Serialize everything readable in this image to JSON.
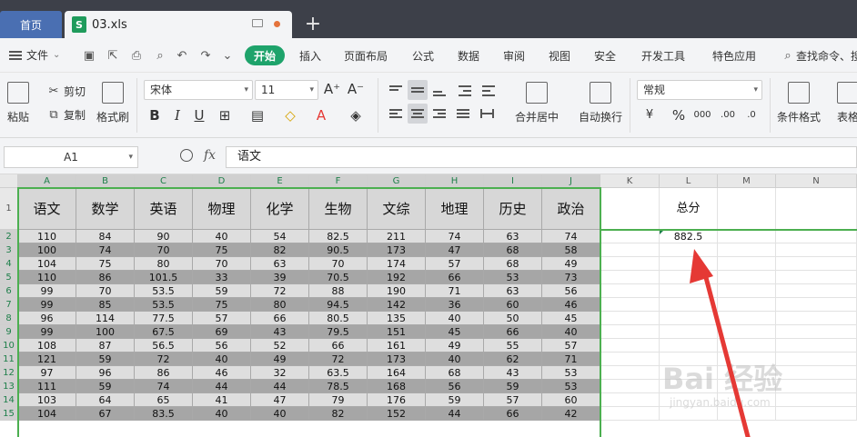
{
  "tabs": {
    "home": "首页",
    "file": "03.xls",
    "file_icon": "S",
    "add": "+"
  },
  "menu": {
    "file": "文件",
    "items": [
      "开始",
      "插入",
      "页面布局",
      "公式",
      "数据",
      "审阅",
      "视图",
      "安全",
      "开发工具",
      "特色应用"
    ],
    "search": "查找命令、搜"
  },
  "ribbon": {
    "paste": "粘贴",
    "cut": "剪切",
    "copy": "复制",
    "format_painter": "格式刷",
    "font_name": "宋体",
    "font_size": "11",
    "merge_center": "合并居中",
    "wrap_text": "自动换行",
    "number_format": "常规",
    "conditional_format": "条件格式",
    "table_style": "表格"
  },
  "formula_bar": {
    "cell_ref": "A1",
    "fx": "fx",
    "content": "语文"
  },
  "grid": {
    "columns": [
      "A",
      "B",
      "C",
      "D",
      "E",
      "F",
      "G",
      "H",
      "I",
      "J",
      "K",
      "L",
      "M",
      "N"
    ],
    "rows": [
      "1",
      "2",
      "3",
      "4",
      "5",
      "6",
      "7",
      "8",
      "9",
      "10",
      "11",
      "12",
      "13",
      "14",
      "15"
    ],
    "headers": [
      "语文",
      "数学",
      "英语",
      "物理",
      "化学",
      "生物",
      "文综",
      "地理",
      "历史",
      "政治"
    ],
    "data": [
      [
        "110",
        "84",
        "90",
        "40",
        "54",
        "82.5",
        "211",
        "74",
        "63",
        "74"
      ],
      [
        "100",
        "74",
        "70",
        "75",
        "82",
        "90.5",
        "173",
        "47",
        "68",
        "58"
      ],
      [
        "104",
        "75",
        "80",
        "70",
        "63",
        "70",
        "174",
        "57",
        "68",
        "49"
      ],
      [
        "110",
        "86",
        "101.5",
        "33",
        "39",
        "70.5",
        "192",
        "66",
        "53",
        "73"
      ],
      [
        "99",
        "70",
        "53.5",
        "59",
        "72",
        "88",
        "190",
        "71",
        "63",
        "56"
      ],
      [
        "99",
        "85",
        "53.5",
        "75",
        "80",
        "94.5",
        "142",
        "36",
        "60",
        "46"
      ],
      [
        "96",
        "114",
        "77.5",
        "57",
        "66",
        "80.5",
        "135",
        "40",
        "50",
        "45"
      ],
      [
        "99",
        "100",
        "67.5",
        "69",
        "43",
        "79.5",
        "151",
        "45",
        "66",
        "40"
      ],
      [
        "108",
        "87",
        "56.5",
        "56",
        "52",
        "66",
        "161",
        "49",
        "55",
        "57"
      ],
      [
        "121",
        "59",
        "72",
        "40",
        "49",
        "72",
        "173",
        "40",
        "62",
        "71"
      ],
      [
        "97",
        "96",
        "86",
        "46",
        "32",
        "63.5",
        "164",
        "68",
        "43",
        "53"
      ],
      [
        "111",
        "59",
        "74",
        "44",
        "44",
        "78.5",
        "168",
        "56",
        "59",
        "53"
      ],
      [
        "103",
        "64",
        "65",
        "41",
        "47",
        "79",
        "176",
        "59",
        "57",
        "60"
      ],
      [
        "104",
        "67",
        "83.5",
        "40",
        "40",
        "82",
        "152",
        "44",
        "66",
        "42"
      ]
    ],
    "total_label": "总分",
    "total_value": "882.5"
  },
  "watermark": {
    "brand": "Bai",
    "brand_cn": "经验",
    "url": "jingyan.baidu.com"
  },
  "colors": {
    "accent": "#1ea36b",
    "home_tab": "#4a6fb2",
    "selection": "#4caf50",
    "arrow": "#e53935",
    "row_dark": "#a6a6a6",
    "row_light": "#dedede"
  }
}
